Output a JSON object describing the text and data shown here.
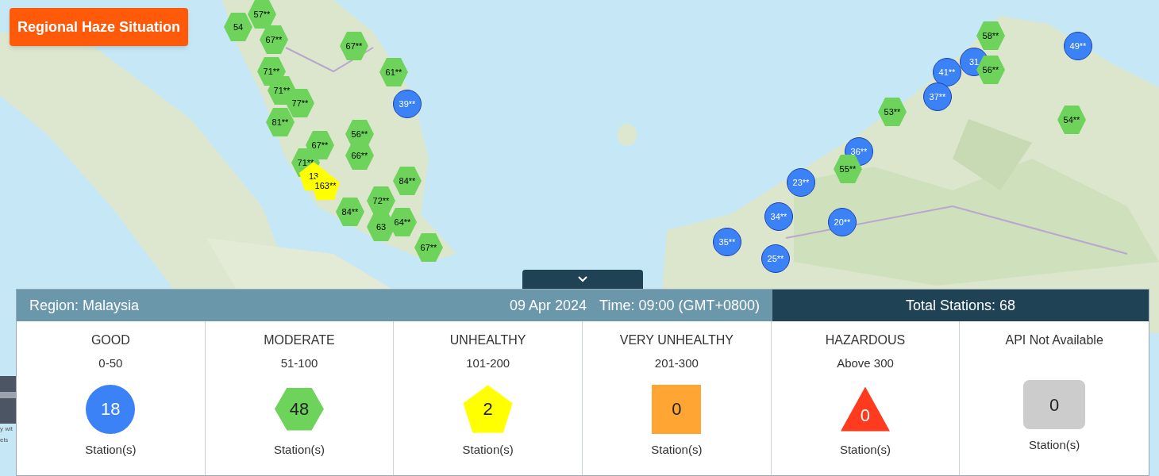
{
  "title_button": "Regional Haze Situation",
  "markers": [
    {
      "kind": "moderate",
      "label": "54"
    },
    {
      "kind": "moderate",
      "label": "57**"
    },
    {
      "kind": "moderate",
      "label": "67**"
    },
    {
      "kind": "moderate",
      "label": "71**"
    },
    {
      "kind": "moderate",
      "label": "71**"
    },
    {
      "kind": "moderate",
      "label": "77**"
    },
    {
      "kind": "moderate",
      "label": "81**"
    },
    {
      "kind": "moderate",
      "label": "67**"
    },
    {
      "kind": "moderate",
      "label": "61**"
    },
    {
      "kind": "good",
      "label": "39**"
    },
    {
      "kind": "moderate",
      "label": "56**"
    },
    {
      "kind": "moderate",
      "label": "66**"
    },
    {
      "kind": "moderate",
      "label": "67**"
    },
    {
      "kind": "moderate",
      "label": "71**"
    },
    {
      "kind": "unhealthy",
      "label": "13"
    },
    {
      "kind": "unhealthy",
      "label": "163**"
    },
    {
      "kind": "moderate",
      "label": "84**"
    },
    {
      "kind": "moderate",
      "label": "63"
    },
    {
      "kind": "moderate",
      "label": "72**"
    },
    {
      "kind": "moderate",
      "label": "84**"
    },
    {
      "kind": "moderate",
      "label": "64**"
    },
    {
      "kind": "moderate",
      "label": "67**"
    },
    {
      "kind": "good",
      "label": "31"
    },
    {
      "kind": "moderate",
      "label": "58**"
    },
    {
      "kind": "good",
      "label": "49**"
    },
    {
      "kind": "good",
      "label": "41**"
    },
    {
      "kind": "moderate",
      "label": "56**"
    },
    {
      "kind": "good",
      "label": "37**"
    },
    {
      "kind": "moderate",
      "label": "53**"
    },
    {
      "kind": "moderate",
      "label": "54**"
    },
    {
      "kind": "good",
      "label": "36**"
    },
    {
      "kind": "moderate",
      "label": "55**"
    },
    {
      "kind": "good",
      "label": "23**"
    },
    {
      "kind": "good",
      "label": "34**"
    },
    {
      "kind": "good",
      "label": "20**"
    },
    {
      "kind": "good",
      "label": "35**"
    },
    {
      "kind": "good",
      "label": "25**"
    }
  ],
  "thumbnail_caption": [
    "y wit",
    "els"
  ],
  "panel": {
    "region": "Region: Malaysia",
    "date": "09 Apr 2024",
    "time": "Time: 09:00 (GMT+0800)",
    "total": "Total Stations: 68",
    "categories": [
      {
        "name": "GOOD",
        "range": "0-50",
        "count": "18",
        "kind": "circle",
        "color": "#3b82f6",
        "unit": "Station(s)"
      },
      {
        "name": "MODERATE",
        "range": "51-100",
        "count": "48",
        "kind": "hexagon",
        "color": "#6ed35a",
        "unit": "Station(s)"
      },
      {
        "name": "UNHEALTHY",
        "range": "101-200",
        "count": "2",
        "kind": "pentagon",
        "color": "#ffff00",
        "unit": "Station(s)"
      },
      {
        "name": "VERY UNHEALTHY",
        "range": "201-300",
        "count": "0",
        "kind": "square",
        "color": "#ffa533",
        "unit": "Station(s)"
      },
      {
        "name": "HAZARDOUS",
        "range": "Above 300",
        "count": "0",
        "kind": "triangle",
        "color": "#ff3b1f",
        "unit": "Station(s)"
      },
      {
        "name": "API Not Available",
        "count": "0",
        "kind": "rounded",
        "color": "#cccccc",
        "unit": "Station(s)"
      }
    ]
  }
}
